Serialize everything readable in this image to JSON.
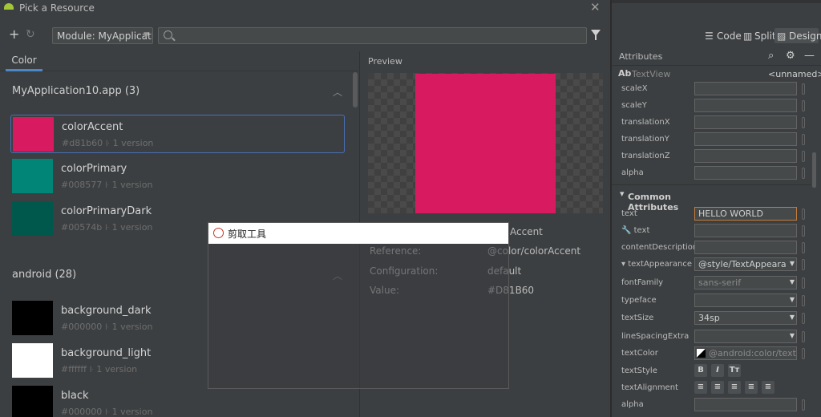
{
  "dialog": {
    "title": "Pick a Resource",
    "module_select": "Module: MyApplicati",
    "search_placeholder": "",
    "tab": "Color",
    "groups": [
      {
        "label": "MyApplication10.app (3)"
      },
      {
        "label": "android (28)"
      }
    ],
    "items": [
      {
        "name": "colorAccent",
        "hex": "#d81b60",
        "version": "1 version",
        "color": "#d81b60",
        "selected": true
      },
      {
        "name": "colorPrimary",
        "hex": "#008577",
        "version": "1 version",
        "color": "#008577"
      },
      {
        "name": "colorPrimaryDark",
        "hex": "#00574b",
        "version": "1 version",
        "color": "#00574b"
      },
      {
        "name": "background_dark",
        "hex": "#000000",
        "version": "1 version",
        "color": "#000000"
      },
      {
        "name": "background_light",
        "hex": "#ffffff",
        "version": "1 version",
        "color": "#ffffff"
      },
      {
        "name": "black",
        "hex": "#000000",
        "version": "1 version",
        "color": "#000000"
      }
    ],
    "preview": {
      "label": "Preview",
      "color": "#d81b60",
      "name_partial": "Accent",
      "rows": [
        {
          "key": "Reference:",
          "value": "@color/colorAccent"
        },
        {
          "key": "Configuration:",
          "value": "default"
        },
        {
          "key": "Value:",
          "value": "#D81B60"
        }
      ]
    }
  },
  "snipping_tool": {
    "title": "剪取工具"
  },
  "right_panel": {
    "view_modes": {
      "code": "Code",
      "split": "Split",
      "design": "Design"
    },
    "attributes_title": "Attributes",
    "widget_type": "TextView",
    "widget_name": "<unnamed>",
    "transform_rows": [
      {
        "label": "scaleX",
        "value": ""
      },
      {
        "label": "scaleY",
        "value": ""
      },
      {
        "label": "translationX",
        "value": ""
      },
      {
        "label": "translationY",
        "value": ""
      },
      {
        "label": "translationZ",
        "value": ""
      },
      {
        "label": "alpha",
        "value": ""
      }
    ],
    "common_title": "Common Attributes",
    "common_rows": [
      {
        "label": "text",
        "value": "HELLO WORLD"
      },
      {
        "label": "text",
        "value": ""
      },
      {
        "label": "contentDescription",
        "value": ""
      },
      {
        "label": "textAppearance",
        "value": "@style/TextAppeara"
      },
      {
        "label": "fontFamily",
        "value": "sans-serif"
      },
      {
        "label": "typeface",
        "value": ""
      },
      {
        "label": "textSize",
        "value": "34sp"
      },
      {
        "label": "lineSpacingExtra",
        "value": ""
      },
      {
        "label": "textColor",
        "value": "@android:color/text_c"
      },
      {
        "label": "textStyle",
        "value": ""
      },
      {
        "label": "textAlignment",
        "value": ""
      },
      {
        "label": "alpha",
        "value": ""
      }
    ],
    "text_style_buttons": [
      "B",
      "I",
      "Tт"
    ]
  },
  "colors": {
    "accent": "#4a88c7",
    "selected_border": "#4a6fb5",
    "focused_field": "#c27d3a"
  }
}
